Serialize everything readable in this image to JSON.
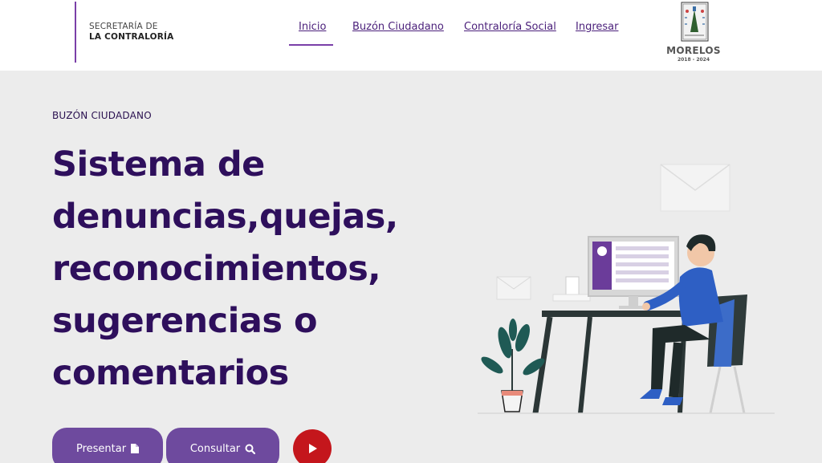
{
  "header": {
    "brand_line1": "SECRETARÍA DE",
    "brand_line2": "LA CONTRALORÍA",
    "nav": [
      {
        "label": "Inicio",
        "active": true
      },
      {
        "label": "Buzón Ciudadano",
        "active": false
      },
      {
        "label": "Contraloría Social",
        "active": false
      },
      {
        "label": "Ingresar",
        "active": false
      }
    ],
    "seal_label": "MORELOS",
    "seal_years": "2018 - 2024"
  },
  "hero": {
    "eyebrow": "BUZÓN CIUDADANO",
    "headline_lines": [
      "Sistema de",
      "denuncias,quejas,",
      "reconocimientos,",
      "sugerencias o",
      "comentarios"
    ],
    "buttons": {
      "present": "Presentar",
      "consult": "Consultar"
    }
  },
  "colors": {
    "accent": "#7a3fa8",
    "headline": "#2e0f5c",
    "button": "#6e4a9e",
    "play": "#c4161c",
    "background": "#ececec"
  },
  "icons": {
    "present": "document-icon",
    "consult": "search-icon",
    "play": "play-icon"
  }
}
